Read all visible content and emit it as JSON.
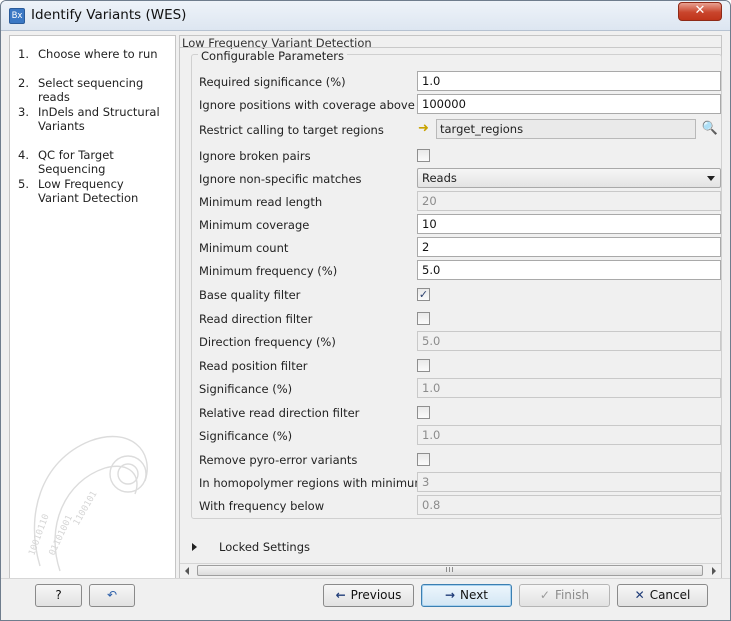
{
  "window": {
    "app_icon_text": "Bx",
    "title": "Identify Variants (WES)",
    "close_glyph": "✕"
  },
  "steps": [
    {
      "num": "1.",
      "label": "Choose where to run"
    },
    {
      "num": "2.",
      "label": "Select sequencing reads"
    },
    {
      "num": "3.",
      "label": "InDels and Structural Variants"
    },
    {
      "num": "4.",
      "label": "QC for Target Sequencing"
    },
    {
      "num": "5.",
      "label": "Low Frequency Variant Detection"
    }
  ],
  "panel": {
    "title": "Low Frequency Variant Detection",
    "group_title": "Configurable Parameters",
    "params": {
      "required_significance": {
        "label": "Required significance (%)",
        "value": "1.0"
      },
      "ignore_coverage_above": {
        "label": "Ignore positions with coverage above",
        "value": "100000"
      },
      "restrict_target": {
        "label": "Restrict calling to target regions",
        "value": "target_regions"
      },
      "ignore_broken_pairs": {
        "label": "Ignore broken pairs",
        "checked": false
      },
      "ignore_nonspecific": {
        "label": "Ignore non-specific matches",
        "value": "Reads"
      },
      "min_read_length": {
        "label": "Minimum read length",
        "value": "20"
      },
      "min_coverage": {
        "label": "Minimum coverage",
        "value": "10"
      },
      "min_count": {
        "label": "Minimum count",
        "value": "2"
      },
      "min_frequency": {
        "label": "Minimum frequency (%)",
        "value": "5.0"
      },
      "base_quality_filter": {
        "label": "Base quality filter",
        "checked": true
      },
      "read_direction_filter": {
        "label": "Read direction filter",
        "checked": false
      },
      "direction_frequency": {
        "label": "Direction frequency (%)",
        "value": "5.0"
      },
      "read_position_filter": {
        "label": "Read position filter",
        "checked": false
      },
      "significance_1": {
        "label": "Significance (%)",
        "value": "1.0"
      },
      "relative_read_direction_filter": {
        "label": "Relative read direction filter",
        "checked": false
      },
      "significance_2": {
        "label": "Significance (%)",
        "value": "1.0"
      },
      "remove_pyro_error": {
        "label": "Remove pyro-error variants",
        "checked": false
      },
      "homopolymer_min_length": {
        "label": "In homopolymer regions with minimum length",
        "value": "3"
      },
      "with_frequency_below": {
        "label": "With frequency below",
        "value": "0.8"
      }
    },
    "locked_settings": "Locked Settings",
    "scroll_grip": "III"
  },
  "footer": {
    "help": "?",
    "reset_glyph": "↶",
    "previous": "Previous",
    "next": "Next",
    "finish": "Finish",
    "cancel": "Cancel"
  },
  "icons": {
    "app": "bx-app-icon",
    "target": "arrow-track-icon",
    "browse": "browse-folder-icon",
    "checkmark": "✓"
  },
  "colors": {
    "accent": "#3c7fb1",
    "close": "#c9452c"
  }
}
